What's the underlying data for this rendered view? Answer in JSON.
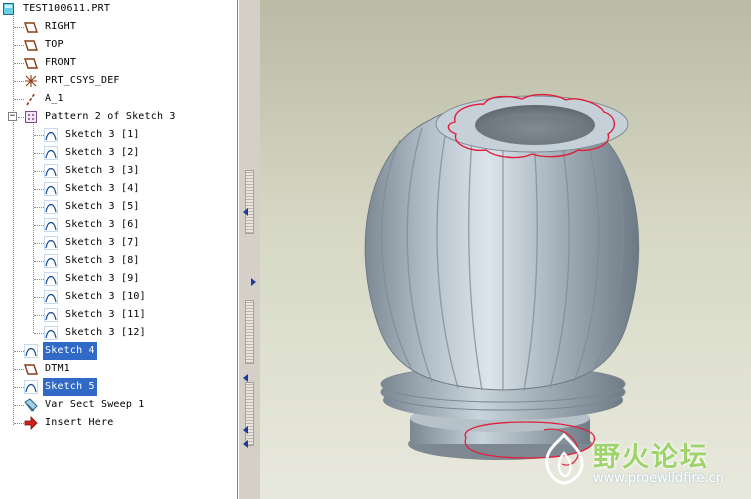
{
  "model_tree": {
    "root": "TEST100611.PRT",
    "items": [
      {
        "label": "RIGHT",
        "icon": "datum-plane-icon"
      },
      {
        "label": "TOP",
        "icon": "datum-plane-icon"
      },
      {
        "label": "FRONT",
        "icon": "datum-plane-icon"
      },
      {
        "label": "PRT_CSYS_DEF",
        "icon": "coordinate-system-icon"
      },
      {
        "label": "A_1",
        "icon": "datum-axis-icon"
      },
      {
        "label": "Pattern 2 of Sketch 3",
        "icon": "pattern-icon",
        "expanded": true
      },
      {
        "label": "Sketch 4",
        "icon": "sketch-icon",
        "selected": true
      },
      {
        "label": "DTM1",
        "icon": "datum-plane-icon"
      },
      {
        "label": "Sketch 5",
        "icon": "sketch-icon",
        "selected": true
      },
      {
        "label": "Var Sect Sweep 1",
        "icon": "sweep-icon"
      },
      {
        "label": "Insert Here",
        "icon": "insert-arrow-icon"
      }
    ],
    "pattern_children": [
      "Sketch 3 [1]",
      "Sketch 3 [2]",
      "Sketch 3 [3]",
      "Sketch 3 [4]",
      "Sketch 3 [5]",
      "Sketch 3 [6]",
      "Sketch 3 [7]",
      "Sketch 3 [8]",
      "Sketch 3 [9]",
      "Sketch 3 [10]",
      "Sketch 3 [11]",
      "Sketch 3 [12]"
    ],
    "expander_symbol": "−"
  },
  "watermark": {
    "title": "野火论坛",
    "url": "www.proewildfire.cn"
  },
  "colors": {
    "selection": "#3169c6",
    "sketch_highlight": "#e0203a",
    "model_body": "#8e9ba6",
    "viewport_top": "#b9bba4",
    "viewport_bottom": "#e8e9dd"
  }
}
